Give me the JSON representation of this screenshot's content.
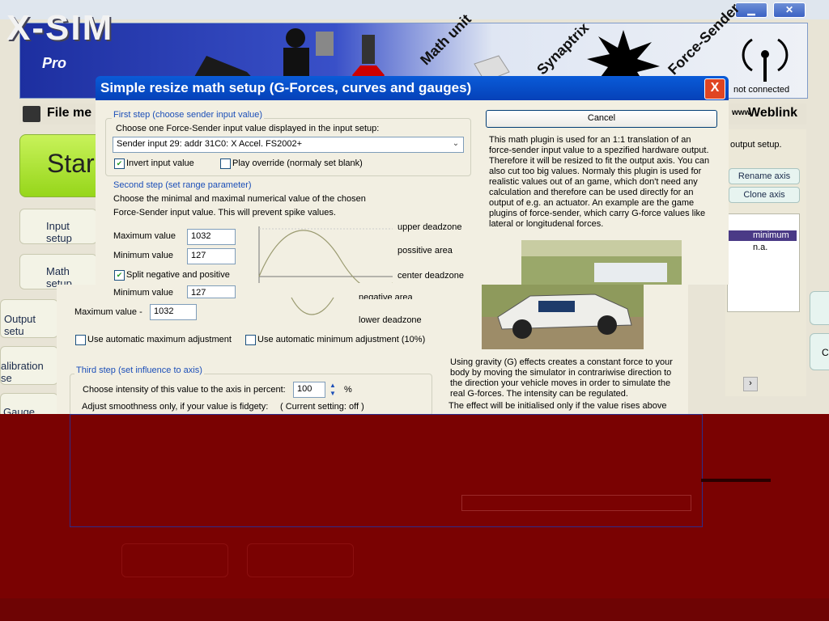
{
  "banner": {
    "logo": "X-SIM",
    "logo_sub": "Pro",
    "words": [
      "Math unit",
      "Synaptrix",
      "Force-Sender"
    ],
    "connection_status": "not connected"
  },
  "menu": {
    "file": "File me",
    "weblink": "Weblink"
  },
  "nav": {
    "start": "Star",
    "input_setup": "Input setup",
    "math_setup": "Math setup",
    "output_setup": "Output setu",
    "calibration_setup": "alibration se",
    "gauge_setup": "Gauge setu"
  },
  "right_panel": {
    "output_setup_text": "output setup.",
    "rename_axis": "Rename axis",
    "clone_axis": "Clone axis",
    "list_minimum": "minimum",
    "list_na": "n.a.",
    "edge_letter": "C"
  },
  "dialog": {
    "title": "Simple resize math setup (G-Forces, curves and gauges)",
    "close": "X",
    "cancel": "Cancel",
    "step1": {
      "heading": "First step (choose sender input value)",
      "prompt": "Choose one Force-Sender input value displayed in the input setup:",
      "selected": "Sender input 29: addr 31C0: X Accel. FS2002+",
      "invert_label": "Invert input value",
      "invert_checked": "✔",
      "override_label": "Play override (normaly set blank)"
    },
    "step2": {
      "heading": "Second step (set range parameter)",
      "desc1": "Choose the minimal and maximal numerical value of the chosen",
      "desc2": "Force-Sender input value. This will prevent spike values.",
      "max_label": "Maximum value",
      "max_value": "1032",
      "min_label": "Minimum value",
      "min_value": "127",
      "split_label": "Split negative and positive",
      "split_checked": "✔",
      "min_label2": "Minimum value",
      "min_value2": "127",
      "max_label2": "Maximum value  -",
      "max_value2": "1032",
      "auto_max": "Use automatic maximum adjustment",
      "auto_min": "Use automatic minimum adjustment (10%)",
      "zones": [
        "upper deadzone",
        "possitive area",
        "center deadzone",
        "negative area",
        "lower deadzone"
      ]
    },
    "step3": {
      "heading": "Third step (set influence to axis)",
      "intensity_label": "Choose intensity of this value to the axis in percent:",
      "intensity_value": "100",
      "percent": "%",
      "smooth_label": "Adjust smoothness only, if your value is fidgety:",
      "smooth_setting": "( Current setting: off )"
    },
    "help": {
      "p1": "This math plugin is used for an 1:1 translation of an force-sender input value to a spezified hardware output. Therefore it will be resized to fit the output axis. You can also cut too big values. Normaly this plugin is used for realistic values out of an game, which don't need any calculation and therefore can be used directly for an output of e.g. an actuator. An example are the game plugins of force-sender, which carry G-force values like lateral or longitudenal forces.",
      "p2": "Using gravity (G) effects creates a constant force to your body by moving the simulator in contrariwise direction to the direction your vehicle moves in order to simulate the real G-forces. The intensity can be regulated.",
      "p3": "The effect will be initialised only if the value rises above"
    }
  },
  "colors": {
    "accent": "#0a5bd8",
    "corrupt": "#7a0202",
    "start_green": "#96d61a"
  }
}
